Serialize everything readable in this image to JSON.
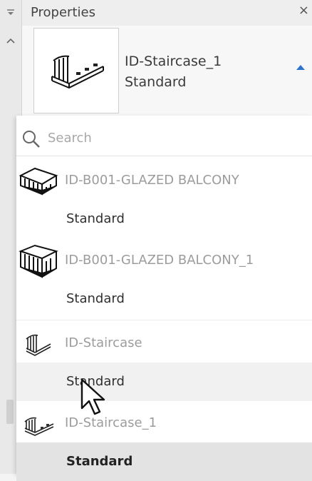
{
  "panel": {
    "title": "Properties",
    "close_label": "×"
  },
  "current_type": {
    "family": "ID-Staircase_1",
    "type": "Standard"
  },
  "search": {
    "placeholder": "Search",
    "value": ""
  },
  "families": [
    {
      "name": "ID-B001-GLAZED BALCONY",
      "icon": "balcony-icon",
      "types": [
        "Standard"
      ]
    },
    {
      "name": "ID-B001-GLAZED BALCONY_1",
      "icon": "balcony-icon",
      "types": [
        "Standard"
      ]
    },
    {
      "name": "ID-Staircase",
      "icon": "staircase-icon",
      "types": [
        "Standard"
      ]
    },
    {
      "name": "ID-Staircase_1",
      "icon": "staircase-icon",
      "types": [
        "Standard"
      ]
    }
  ],
  "colors": {
    "accent": "#2c74c9",
    "family_text": "#9c9c9c",
    "selected_bg": "#e3e3e3"
  }
}
